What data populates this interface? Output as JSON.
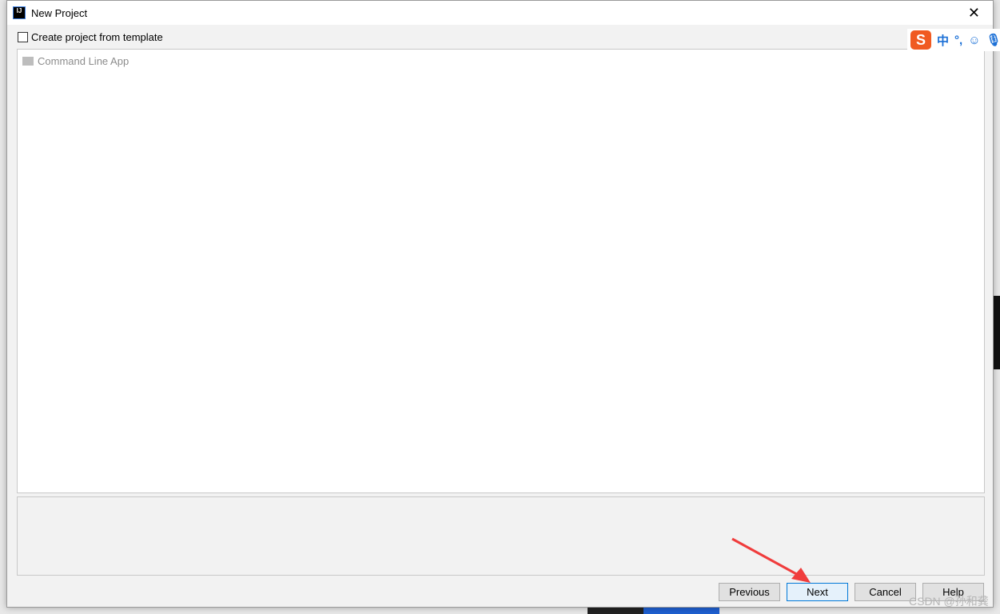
{
  "window": {
    "title": "New Project",
    "close_icon": "close-icon"
  },
  "template": {
    "label": "Create project from template",
    "checked": false
  },
  "list": {
    "items": [
      {
        "label": "Command Line App",
        "icon": "folder-icon"
      }
    ]
  },
  "buttons": {
    "previous": "Previous",
    "next": "Next",
    "cancel": "Cancel",
    "help": "Help"
  },
  "ime": {
    "mode": "中",
    "punct": "°,"
  },
  "watermark": "CSDN @孙和龚",
  "annotation_color": "#f03c3c"
}
